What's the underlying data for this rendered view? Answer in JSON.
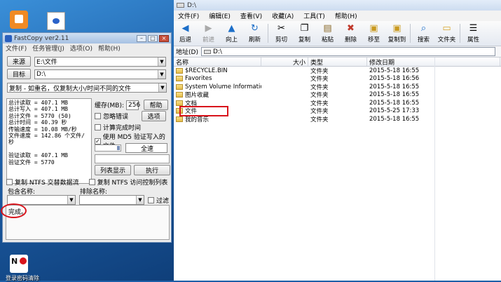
{
  "desktop": {
    "top_icons": [
      "app-orange-icon",
      "media-file-icon"
    ],
    "bottom_icon_label": "登录密码清除"
  },
  "fastcopy": {
    "title": "FastCopy ver2.11",
    "menu": [
      "文件(F)",
      "任务管理(J)",
      "选项(O)",
      "帮助(H)"
    ],
    "source_btn": "来源",
    "source_value": "E:\\文件",
    "dest_btn": "目标",
    "dest_value": "D:\\",
    "mode": "复制 - 如重名，仅复制大小/时间不同的文件",
    "stats": [
      "总计读取 = 407.1 MB",
      "总计写入 = 407.1 MB",
      "总计文件 = 5770 (50)",
      "总计时间 = 40.39 秒",
      "传输速度 = 10.08 MB/秒",
      "文件速度 = 142.86 个文件/秒",
      "",
      "验证读取 = 407.1 MB",
      "验证文件 = 5770"
    ],
    "buffer_label": "缓存(MB):",
    "buffer_value": "256",
    "help_btn": "帮助",
    "ignore_errors": "忽略错误",
    "options_btn": "选项",
    "estimate": "计算完成时间",
    "verify_md5": "使用 MD5 验证写入的文件",
    "full_speed": "全速",
    "list_btn": "列表显示",
    "exec_btn": "执行",
    "ntfs_streams": "复制 NTFS 交替数据流",
    "ntfs_acl": "复制 NTFS 访问控制列表",
    "include_label": "包含名称:",
    "exclude_label": "排除名称:",
    "filter": "过滤",
    "status": "完成。"
  },
  "explorer": {
    "title": "D:\\",
    "menu": [
      "文件(F)",
      "编辑(E)",
      "查看(V)",
      "收藏(A)",
      "工具(T)",
      "帮助(H)"
    ],
    "toolbar": [
      {
        "label": "后退",
        "icon": "back-arrow-icon"
      },
      {
        "label": "前进",
        "icon": "forward-arrow-icon"
      },
      {
        "label": "向上",
        "icon": "up-arrow-icon"
      },
      {
        "label": "刷新",
        "icon": "refresh-icon"
      },
      {
        "label": "剪切",
        "icon": "scissors-icon"
      },
      {
        "label": "复制",
        "icon": "copy-icon"
      },
      {
        "label": "粘贴",
        "icon": "paste-icon"
      },
      {
        "label": "删除",
        "icon": "delete-icon"
      },
      {
        "label": "移至",
        "icon": "move-to-icon"
      },
      {
        "label": "复制到",
        "icon": "copy-to-icon"
      },
      {
        "label": "搜索",
        "icon": "search-icon"
      },
      {
        "label": "文件夹",
        "icon": "folder-tree-icon"
      },
      {
        "label": "属性",
        "icon": "properties-icon"
      }
    ],
    "address_label": "地址(D)",
    "address_value": "D:\\",
    "columns": {
      "name": "名称",
      "size": "大小",
      "type": "类型",
      "modified": "修改日期"
    },
    "rows": [
      {
        "name": "$RECYCLE.BIN",
        "type": "文件夹",
        "modified": "2015-5-18 16:55"
      },
      {
        "name": "Favorites",
        "type": "文件夹",
        "modified": "2015-5-18 16:56"
      },
      {
        "name": "System Volume Information",
        "type": "文件夹",
        "modified": "2015-5-18 16:55"
      },
      {
        "name": "图片收藏",
        "type": "文件夹",
        "modified": "2015-5-18 16:55"
      },
      {
        "name": "文档",
        "type": "文件夹",
        "modified": "2015-5-18 16:55"
      },
      {
        "name": "文件",
        "type": "文件夹",
        "modified": "2015-5-25 17:33"
      },
      {
        "name": "我的音乐",
        "type": "文件夹",
        "modified": "2015-5-18 16:55"
      }
    ]
  }
}
